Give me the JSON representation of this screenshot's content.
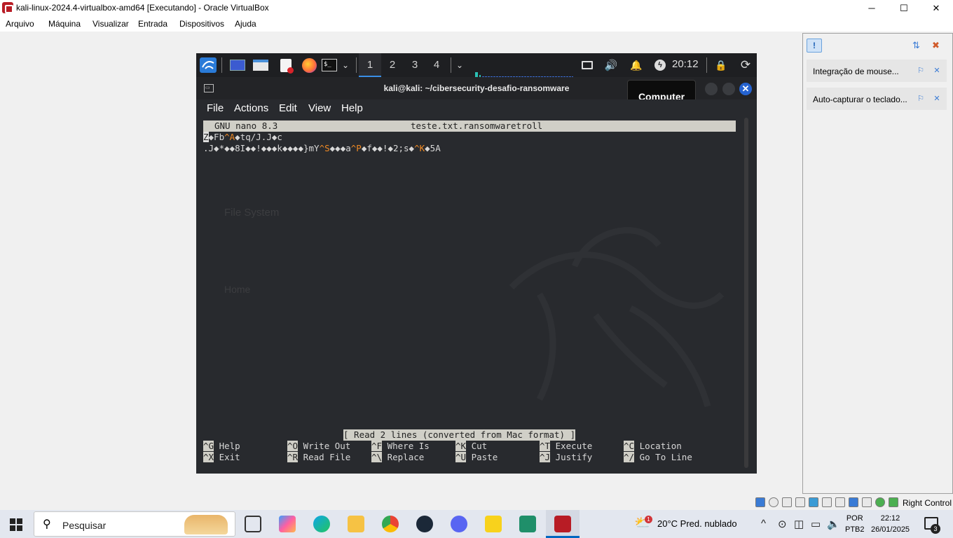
{
  "window": {
    "title": "kali-linux-2024.4-virtualbox-amd64 [Executando] - Oracle VirtualBox",
    "minimize": "─",
    "maximize": "☐",
    "close": "✕"
  },
  "vbox_menu": [
    "Arquivo",
    "Máquina",
    "Visualizar",
    "Entrada",
    "Dispositivos",
    "Ajuda"
  ],
  "kali_panel": {
    "workspaces": [
      "1",
      "2",
      "3",
      "4"
    ],
    "clock": "20:12"
  },
  "terminal": {
    "title": "kali@kali: ~/cibersecurity-desafio-ransomware",
    "tooltip": "Computer",
    "menu": [
      "File",
      "Actions",
      "Edit",
      "View",
      "Help"
    ],
    "desktop_ghost_labels": [
      "File System",
      "Home"
    ]
  },
  "nano": {
    "version": "GNU nano 8.3",
    "filename": "teste.txt.ransomwaretroll",
    "line1": {
      "cursor": "Z",
      "parts": [
        "◆Fb",
        "^A",
        "◆tq/J.J◆c"
      ]
    },
    "line2": {
      "parts": [
        ".J◆*◆◆8I◆◆!◆◆◆k◆◆◆◆}mY",
        "^S",
        "◆◆◆a",
        "^P",
        "◆f◆◆!◆2;s◆",
        "^K",
        "◆5A"
      ]
    },
    "status": "[ Read 2 lines (converted from Mac format) ]",
    "shortcuts": [
      {
        "key": "^G",
        "label": "Help"
      },
      {
        "key": "^O",
        "label": "Write Out"
      },
      {
        "key": "^F",
        "label": "Where Is"
      },
      {
        "key": "^K",
        "label": "Cut"
      },
      {
        "key": "^T",
        "label": "Execute"
      },
      {
        "key": "^C",
        "label": "Location"
      },
      {
        "key": "^X",
        "label": "Exit"
      },
      {
        "key": "^R",
        "label": "Read File"
      },
      {
        "key": "^\\",
        "label": "Replace"
      },
      {
        "key": "^U",
        "label": "Paste"
      },
      {
        "key": "^J",
        "label": "Justify"
      },
      {
        "key": "^/",
        "label": "Go To Line"
      }
    ]
  },
  "side_panel": {
    "items": [
      "Integração de mouse...",
      "Auto-capturar o teclado..."
    ]
  },
  "vbox_status": {
    "host_key": "Right Control"
  },
  "taskbar": {
    "search_placeholder": "Pesquisar",
    "weather": "20°C  Pred. nublado",
    "weather_badge": "1",
    "lang": "POR",
    "layout": "PTB2",
    "time": "22:12",
    "date": "26/01/2025",
    "notifications": "3"
  },
  "colors": {
    "terminal_bg": "#282a2e",
    "nano_header_bg": "#d0cfc7",
    "control_char": "#f08a24",
    "taskbar_bg": "#e3e7ef"
  }
}
